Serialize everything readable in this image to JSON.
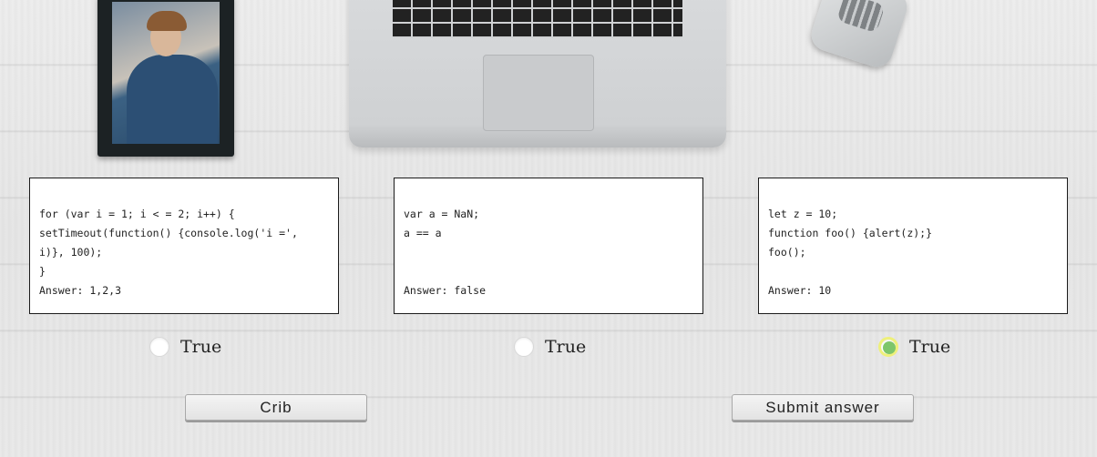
{
  "questions": [
    {
      "code": "for (var i = 1; i < = 2; i++) {\nsetTimeout(function() {console.log('i =', i)}, 100);\n}\nAnswer: 1,2,3",
      "option_label": "True",
      "selected": false
    },
    {
      "code": "var a = NaN;\na == a\n\n\nAnswer: false",
      "option_label": "True",
      "selected": false
    },
    {
      "code": "let z = 10;\nfunction foo() {alert(z);}\nfoo();\n\nAnswer: 10",
      "option_label": "True",
      "selected": true
    }
  ],
  "buttons": {
    "crib_label": "Crib",
    "submit_label": "Submit answer"
  },
  "colors": {
    "radio_selected_fill": "#7ec66a",
    "radio_selected_ring": "#eef07a",
    "card_border": "#1b1b1b"
  }
}
